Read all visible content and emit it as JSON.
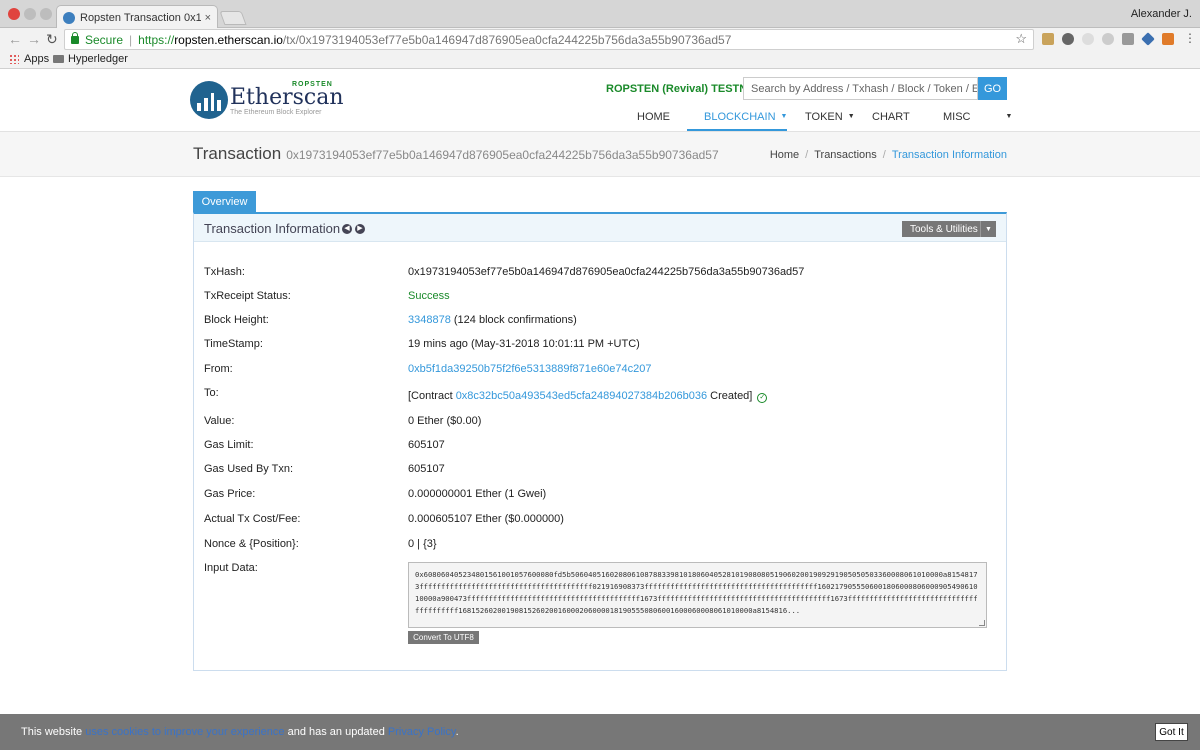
{
  "browser": {
    "tab_title": "Ropsten Transaction 0x19731",
    "tab_close": "×",
    "user": "Alexander J.",
    "secure_label": "Secure",
    "url_scheme": "https://",
    "url_host": "ropsten.etherscan.io",
    "url_path": "/tx/0x1973194053ef77e5b0a146947d876905ea0cfa244225b756da3a55b90736ad57",
    "bookmarks": [
      "Apps",
      "Hyperledger"
    ]
  },
  "header": {
    "logo_word": "Etherscan",
    "logo_ropsten": "ROPSTEN",
    "logo_tagline": "The Ethereum Block Explorer",
    "testnet_label": "ROPSTEN (Revival) TESTNET",
    "search_placeholder": "Search by Address / Txhash / Block / Token / Ens",
    "search_button": "GO",
    "nav": [
      "HOME",
      "BLOCKCHAIN",
      "TOKEN",
      "CHART",
      "MISC"
    ]
  },
  "titlebar": {
    "title": "Transaction",
    "hash": "0x1973194053ef77e5b0a146947d876905ea0cfa244225b756da3a55b90736ad57",
    "breadcrumb": [
      "Home",
      "Transactions",
      "Transaction Information"
    ]
  },
  "panel": {
    "tab": "Overview",
    "title": "Transaction Information",
    "tools": "Tools & Utilities",
    "rows": {
      "txhash_label": "TxHash:",
      "txhash_value": "0x1973194053ef77e5b0a146947d876905ea0cfa244225b756da3a55b90736ad57",
      "status_label": "TxReceipt Status:",
      "status_value": "Success",
      "block_label": "Block Height:",
      "block_value": "3348878",
      "block_confirm": " (124 block confirmations)",
      "time_label": "TimeStamp:",
      "time_value": "19 mins ago (May-31-2018 10:01:11 PM +UTC)",
      "from_label": "From:",
      "from_value": "0xb5f1da39250b75f2f6e5313889f871e60e74c207",
      "to_label": "To:",
      "to_prefix": "[Contract ",
      "to_value": "0x8c32bc50a493543ed5cfa24894027384b206b036",
      "to_suffix": " Created]",
      "value_label": "Value:",
      "value_value": "0 Ether ($0.00)",
      "gaslimit_label": "Gas Limit:",
      "gaslimit_value": "605107",
      "gasused_label": "Gas Used By Txn:",
      "gasused_value": "605107",
      "gasprice_label": "Gas Price:",
      "gasprice_value": "0.000000001 Ether (1 Gwei)",
      "cost_label": "Actual Tx Cost/Fee:",
      "cost_value": "0.000605107 Ether ($0.000000)",
      "nonce_label": "Nonce & {Position}:",
      "nonce_value": "0 | {3}",
      "input_label": "Input Data:",
      "input_value": "0x608060405234801561001057600080fd5b50604051602080610878833981018060405281019080805190602001909291905050503360008061010000a81548173ffffffffffffffffffffffffffffffffffffffff021916908373ffffffffffffffffffffffffffffffffffffffff160217905550600180600080600090549061010000a900473ffffffffffffffffffffffffffffffffffffffff1673ffffffffffffffffffffffffffffffffffffffff1673ffffffffffffffffffffffffffffffffffffffff16815260200190815260200160002060000181905550806001600060008061010000a8154816...",
      "convert_button": "Convert To UTF8"
    }
  },
  "cookie": {
    "text1": "This website ",
    "link1": "uses cookies to improve your experience",
    "text2": " and has an updated ",
    "link2": "Privacy Policy",
    "text3": ".",
    "button": "Got It"
  }
}
